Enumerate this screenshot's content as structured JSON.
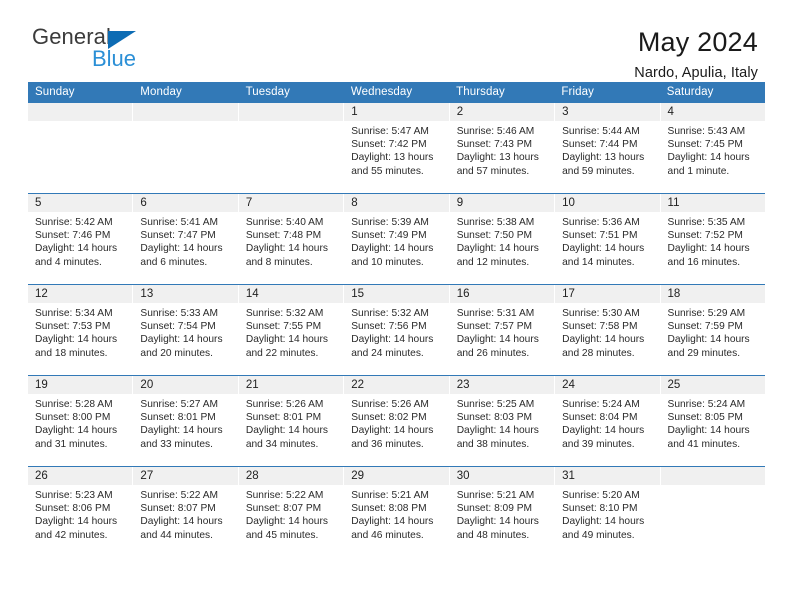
{
  "brand": {
    "name_part1": "General",
    "name_part2": "Blue",
    "colors": {
      "dark": "#3b3b3b",
      "blue": "#2b8fd6",
      "triangle": "#0d6cb4"
    }
  },
  "header": {
    "title": "May 2024",
    "subtitle": "Nardo, Apulia, Italy"
  },
  "theme": {
    "header_blue": "#3279b7",
    "daynum_band": "#f0f0f0",
    "text": "#222222"
  },
  "weekdays": [
    "Sunday",
    "Monday",
    "Tuesday",
    "Wednesday",
    "Thursday",
    "Friday",
    "Saturday"
  ],
  "weeks": [
    [
      {
        "day": "",
        "sunrise": "",
        "sunset": "",
        "daylight": "",
        "empty": true
      },
      {
        "day": "",
        "sunrise": "",
        "sunset": "",
        "daylight": "",
        "empty": true
      },
      {
        "day": "",
        "sunrise": "",
        "sunset": "",
        "daylight": "",
        "empty": true
      },
      {
        "day": "1",
        "sunrise": "Sunrise: 5:47 AM",
        "sunset": "Sunset: 7:42 PM",
        "daylight": "Daylight: 13 hours and 55 minutes."
      },
      {
        "day": "2",
        "sunrise": "Sunrise: 5:46 AM",
        "sunset": "Sunset: 7:43 PM",
        "daylight": "Daylight: 13 hours and 57 minutes."
      },
      {
        "day": "3",
        "sunrise": "Sunrise: 5:44 AM",
        "sunset": "Sunset: 7:44 PM",
        "daylight": "Daylight: 13 hours and 59 minutes."
      },
      {
        "day": "4",
        "sunrise": "Sunrise: 5:43 AM",
        "sunset": "Sunset: 7:45 PM",
        "daylight": "Daylight: 14 hours and 1 minute."
      }
    ],
    [
      {
        "day": "5",
        "sunrise": "Sunrise: 5:42 AM",
        "sunset": "Sunset: 7:46 PM",
        "daylight": "Daylight: 14 hours and 4 minutes."
      },
      {
        "day": "6",
        "sunrise": "Sunrise: 5:41 AM",
        "sunset": "Sunset: 7:47 PM",
        "daylight": "Daylight: 14 hours and 6 minutes."
      },
      {
        "day": "7",
        "sunrise": "Sunrise: 5:40 AM",
        "sunset": "Sunset: 7:48 PM",
        "daylight": "Daylight: 14 hours and 8 minutes."
      },
      {
        "day": "8",
        "sunrise": "Sunrise: 5:39 AM",
        "sunset": "Sunset: 7:49 PM",
        "daylight": "Daylight: 14 hours and 10 minutes."
      },
      {
        "day": "9",
        "sunrise": "Sunrise: 5:38 AM",
        "sunset": "Sunset: 7:50 PM",
        "daylight": "Daylight: 14 hours and 12 minutes."
      },
      {
        "day": "10",
        "sunrise": "Sunrise: 5:36 AM",
        "sunset": "Sunset: 7:51 PM",
        "daylight": "Daylight: 14 hours and 14 minutes."
      },
      {
        "day": "11",
        "sunrise": "Sunrise: 5:35 AM",
        "sunset": "Sunset: 7:52 PM",
        "daylight": "Daylight: 14 hours and 16 minutes."
      }
    ],
    [
      {
        "day": "12",
        "sunrise": "Sunrise: 5:34 AM",
        "sunset": "Sunset: 7:53 PM",
        "daylight": "Daylight: 14 hours and 18 minutes."
      },
      {
        "day": "13",
        "sunrise": "Sunrise: 5:33 AM",
        "sunset": "Sunset: 7:54 PM",
        "daylight": "Daylight: 14 hours and 20 minutes."
      },
      {
        "day": "14",
        "sunrise": "Sunrise: 5:32 AM",
        "sunset": "Sunset: 7:55 PM",
        "daylight": "Daylight: 14 hours and 22 minutes."
      },
      {
        "day": "15",
        "sunrise": "Sunrise: 5:32 AM",
        "sunset": "Sunset: 7:56 PM",
        "daylight": "Daylight: 14 hours and 24 minutes."
      },
      {
        "day": "16",
        "sunrise": "Sunrise: 5:31 AM",
        "sunset": "Sunset: 7:57 PM",
        "daylight": "Daylight: 14 hours and 26 minutes."
      },
      {
        "day": "17",
        "sunrise": "Sunrise: 5:30 AM",
        "sunset": "Sunset: 7:58 PM",
        "daylight": "Daylight: 14 hours and 28 minutes."
      },
      {
        "day": "18",
        "sunrise": "Sunrise: 5:29 AM",
        "sunset": "Sunset: 7:59 PM",
        "daylight": "Daylight: 14 hours and 29 minutes."
      }
    ],
    [
      {
        "day": "19",
        "sunrise": "Sunrise: 5:28 AM",
        "sunset": "Sunset: 8:00 PM",
        "daylight": "Daylight: 14 hours and 31 minutes."
      },
      {
        "day": "20",
        "sunrise": "Sunrise: 5:27 AM",
        "sunset": "Sunset: 8:01 PM",
        "daylight": "Daylight: 14 hours and 33 minutes."
      },
      {
        "day": "21",
        "sunrise": "Sunrise: 5:26 AM",
        "sunset": "Sunset: 8:01 PM",
        "daylight": "Daylight: 14 hours and 34 minutes."
      },
      {
        "day": "22",
        "sunrise": "Sunrise: 5:26 AM",
        "sunset": "Sunset: 8:02 PM",
        "daylight": "Daylight: 14 hours and 36 minutes."
      },
      {
        "day": "23",
        "sunrise": "Sunrise: 5:25 AM",
        "sunset": "Sunset: 8:03 PM",
        "daylight": "Daylight: 14 hours and 38 minutes."
      },
      {
        "day": "24",
        "sunrise": "Sunrise: 5:24 AM",
        "sunset": "Sunset: 8:04 PM",
        "daylight": "Daylight: 14 hours and 39 minutes."
      },
      {
        "day": "25",
        "sunrise": "Sunrise: 5:24 AM",
        "sunset": "Sunset: 8:05 PM",
        "daylight": "Daylight: 14 hours and 41 minutes."
      }
    ],
    [
      {
        "day": "26",
        "sunrise": "Sunrise: 5:23 AM",
        "sunset": "Sunset: 8:06 PM",
        "daylight": "Daylight: 14 hours and 42 minutes."
      },
      {
        "day": "27",
        "sunrise": "Sunrise: 5:22 AM",
        "sunset": "Sunset: 8:07 PM",
        "daylight": "Daylight: 14 hours and 44 minutes."
      },
      {
        "day": "28",
        "sunrise": "Sunrise: 5:22 AM",
        "sunset": "Sunset: 8:07 PM",
        "daylight": "Daylight: 14 hours and 45 minutes."
      },
      {
        "day": "29",
        "sunrise": "Sunrise: 5:21 AM",
        "sunset": "Sunset: 8:08 PM",
        "daylight": "Daylight: 14 hours and 46 minutes."
      },
      {
        "day": "30",
        "sunrise": "Sunrise: 5:21 AM",
        "sunset": "Sunset: 8:09 PM",
        "daylight": "Daylight: 14 hours and 48 minutes."
      },
      {
        "day": "31",
        "sunrise": "Sunrise: 5:20 AM",
        "sunset": "Sunset: 8:10 PM",
        "daylight": "Daylight: 14 hours and 49 minutes."
      },
      {
        "day": "",
        "sunrise": "",
        "sunset": "",
        "daylight": "",
        "empty": true
      }
    ]
  ]
}
